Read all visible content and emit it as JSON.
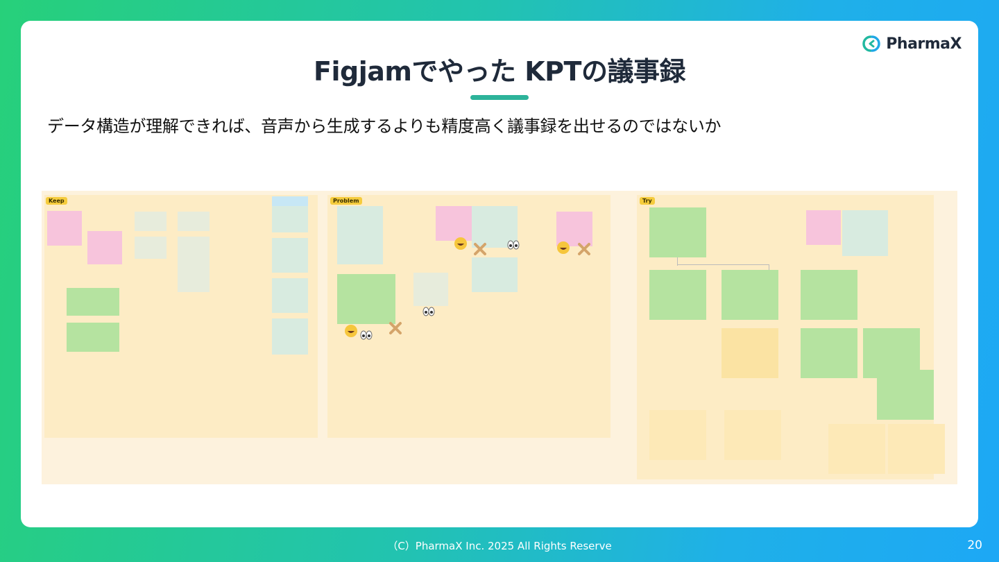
{
  "logo": {
    "text": "PharmaX",
    "icon": "pharmax-logo-icon"
  },
  "title": "Figjamでやった KPTの議事録",
  "subtitle": "データ構造が理解できれば、音声から生成するよりも精度高く議事録を出せるのではないか",
  "board": {
    "sections": [
      {
        "label": "Keep"
      },
      {
        "label": "Problem"
      },
      {
        "label": "Try"
      }
    ]
  },
  "footer": "（C）PharmaX Inc. 2025  All Rights Reserve",
  "page_number": "20",
  "colors": {
    "accent": "#2db39a",
    "title_text": "#1f2a3a",
    "board_bg": "#fdf2dd",
    "sticky_green": "#b5e3a0",
    "sticky_pink": "#f7c4dc",
    "sticky_yellow": "#fbe3a3",
    "section_label": "#f5cc3d"
  }
}
